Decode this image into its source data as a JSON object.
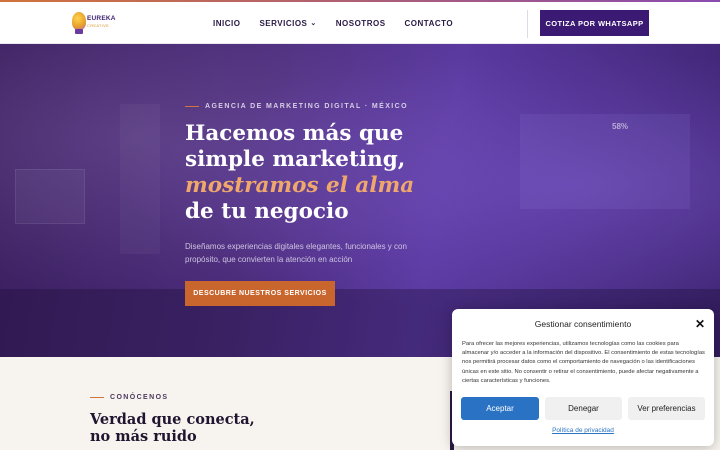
{
  "logo": {
    "name": "EUREKA",
    "sub": "CREATIVE"
  },
  "nav": {
    "items": [
      {
        "label": "INICIO"
      },
      {
        "label": "SERVICIOS"
      },
      {
        "label": "NOSOTROS"
      },
      {
        "label": "CONTACTO"
      }
    ],
    "cta_label": "COTIZA POR WHATSAPP"
  },
  "hero": {
    "kicker": "AGENCIA DE MARKETING DIGITAL · MÉXICO",
    "title_line1": "Hacemos más que",
    "title_line2": "simple marketing,",
    "title_accent": "mostramos el alma",
    "title_line4": "de tu negocio",
    "description": "Diseñamos experiencias digitales elegantes, funcionales y con propósito, que convierten la atención en acción",
    "button_label": "DESCUBRE NUESTROS SERVICIOS",
    "background_badge": "58%"
  },
  "about": {
    "kicker": "CONÓCENOS",
    "title_line1": "Verdad que conecta,",
    "title_line2": "no más ruido"
  },
  "consent": {
    "title": "Gestionar consentimiento",
    "text": "Para ofrecer las mejores experiencias, utilizamos tecnologías como las cookies para almacenar y/o acceder a la información del dispositivo. El consentimiento de estas tecnologías nos permitirá procesar datos como el comportamiento de navegación o las identificaciones únicas en este sitio. No consentir o retirar el consentimiento, puede afectar negativamente a ciertas características y funciones.",
    "accept_label": "Aceptar",
    "deny_label": "Denegar",
    "prefs_label": "Ver preferencias",
    "privacy_link": "Política de privacidad"
  },
  "colors": {
    "brand_purple": "#3b1a73",
    "accent_orange": "#c9662e",
    "consent_blue": "#2a73c4"
  }
}
